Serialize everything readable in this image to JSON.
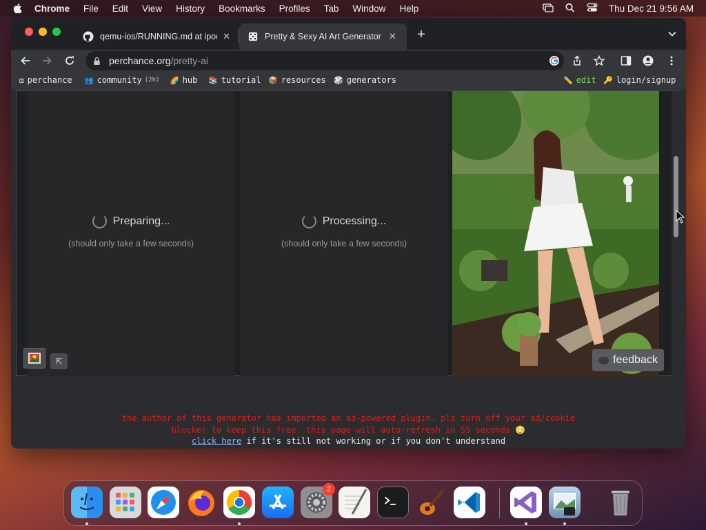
{
  "menubar": {
    "app_name": "Chrome",
    "menus": [
      "File",
      "Edit",
      "View",
      "History",
      "Bookmarks",
      "Profiles",
      "Tab",
      "Window",
      "Help"
    ],
    "clock": "Thu Dec 21  9:56 AM"
  },
  "tabs": [
    {
      "title": "qemu-ios/RUNNING.md at ipod",
      "favicon": "github-icon"
    },
    {
      "title": "Pretty & Sexy AI Art Generator",
      "favicon": "dice-icon"
    }
  ],
  "toolbar": {
    "url_host": "perchance.org",
    "url_path": "/pretty-ai"
  },
  "bookmarks": {
    "left": [
      {
        "icon": "⚄",
        "label": "perchance"
      },
      {
        "icon": "👥",
        "label": "community",
        "extra": "(2h)"
      },
      {
        "icon": "🌈",
        "label": "hub"
      },
      {
        "icon": "📚",
        "label": "tutorial"
      },
      {
        "icon": "📦",
        "label": "resources"
      },
      {
        "icon": "🎲",
        "label": "generators"
      }
    ],
    "edit": {
      "icon": "✏️",
      "label": "edit"
    },
    "login": {
      "icon": "🔑",
      "label": "login/signup"
    }
  },
  "gallery": {
    "panel1_status": "Preparing...",
    "panel1_sub": "(should only take a few seconds)",
    "panel2_status": "Processing...",
    "panel2_sub": "(should only take a few seconds)",
    "feedback_label": "feedback",
    "expand_icon": "⇱"
  },
  "notice": {
    "line1": "the author of this generator has imported an ad-powered plugin. pls turn off your ad/cookie",
    "line2": "blocker to keep this free. this page will auto-refresh in 55 seconds 😳",
    "link_text": "click here",
    "line3_rest": " if it's still not working or if you don't understand"
  },
  "dock": {
    "apps": [
      "finder-icon",
      "launchpad-icon",
      "safari-icon",
      "firefox-icon",
      "chrome-icon",
      "app-store-icon",
      "system-settings-icon",
      "textedit-icon",
      "terminal-icon",
      "garageband-icon",
      "vscode-icon",
      "visual-studio-icon",
      "preview-icon",
      "trash-icon"
    ],
    "settings_badge": "2"
  },
  "colors": {
    "notice_red": "#d6201b",
    "link_blue": "#8ab4f8",
    "edit_green": "#7ed957"
  }
}
